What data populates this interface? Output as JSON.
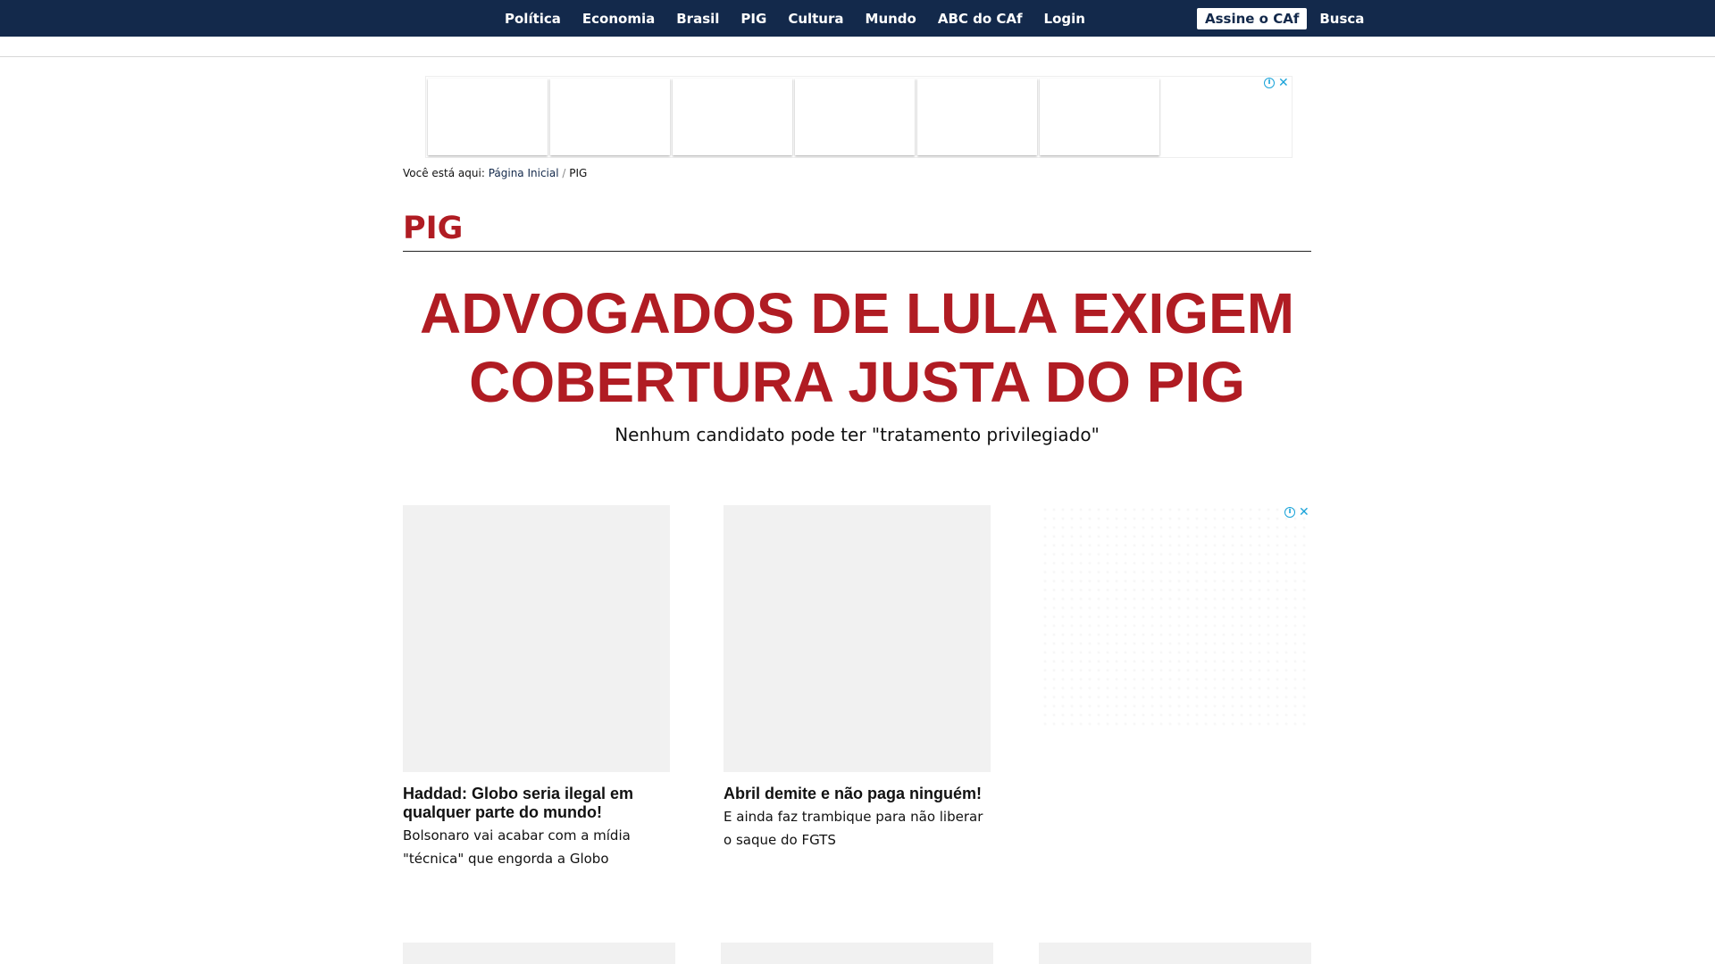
{
  "nav": {
    "items": [
      {
        "label": "Política"
      },
      {
        "label": "Economia"
      },
      {
        "label": "Brasil"
      },
      {
        "label": "PIG"
      },
      {
        "label": "Cultura"
      },
      {
        "label": "Mundo"
      },
      {
        "label": "ABC do CAf"
      },
      {
        "label": "Login"
      }
    ],
    "subscribe_label": "Assine o CAf",
    "search_label": "Busca"
  },
  "ads": {
    "info_icon": "info-icon",
    "close_icon": "close-icon",
    "close_glyph": "✕",
    "info_glyph": "i"
  },
  "breadcrumb": {
    "prefix": "Você está aqui: ",
    "home": "Página Inicial",
    "separator": " / ",
    "current": "PIG"
  },
  "section": {
    "title": "PIG"
  },
  "article": {
    "headline_line1": "ADVOGADOS DE LULA EXIGEM",
    "headline_line2": "COBERTURA JUSTA DO PIG",
    "subtitle": "Nenhum candidato pode ter \"tratamento privilegiado\""
  },
  "cards": [
    {
      "title_line1": "Haddad: Globo seria ilegal em",
      "title_line2": "qualquer parte do mundo!",
      "desc_line1": "Bolsonaro vai acabar com a mídia",
      "desc_line2": "\"técnica\" que engorda a Globo"
    },
    {
      "title_line1": "Abril demite e não paga ninguém!",
      "desc_line1": "E ainda faz trambique para não liberar",
      "desc_line2": "o saque do FGTS"
    }
  ],
  "colors": {
    "nav_bg": "#13294b",
    "accent_red": "#b01c23",
    "ad_icon": "#1aa3d9",
    "placeholder": "#f1f1f1"
  }
}
